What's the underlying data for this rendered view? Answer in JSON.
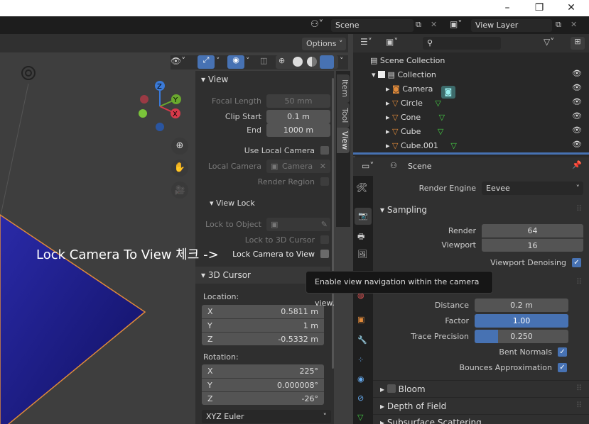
{
  "window": {
    "minimize": "–",
    "maximize": "❐",
    "close": "✕"
  },
  "topbar": {
    "scene": "Scene",
    "view_layer": "View Layer"
  },
  "viewport": {
    "options": "Options"
  },
  "npanel": {
    "tabs": [
      "Item",
      "Tool",
      "View"
    ],
    "view": {
      "header": "View",
      "focal_length_label": "Focal Length",
      "focal_length": "50 mm",
      "clip_start_label": "Clip Start",
      "clip_start": "0.1 m",
      "end_label": "End",
      "end": "1000 m",
      "use_local_camera": "Use Local Camera",
      "local_camera_label": "Local Camera",
      "local_camera_value": "Camera",
      "render_region": "Render Region"
    },
    "view_lock": {
      "header": "View Lock",
      "lock_to_object_label": "Lock to Object",
      "lock_to_3d_cursor": "Lock to 3D Cursor",
      "lock_camera_to_view": "Lock Camera to View"
    },
    "cursor": {
      "header": "3D Cursor",
      "location_label": "Location:",
      "location": [
        {
          "axis": "X",
          "value": "0.5811 m"
        },
        {
          "axis": "Y",
          "value": "1 m"
        },
        {
          "axis": "Z",
          "value": "-0.5332 m"
        }
      ],
      "rotation_label": "Rotation:",
      "rotation": [
        {
          "axis": "X",
          "value": "225°"
        },
        {
          "axis": "Y",
          "value": "0.000008°"
        },
        {
          "axis": "Z",
          "value": "-26°"
        }
      ],
      "rotation_mode": "XYZ Euler"
    }
  },
  "annotation": "Lock Camera To View 체크 ->",
  "tooltip": "Enable view navigation within the camera view.",
  "outliner": {
    "root": "Scene Collection",
    "collection": "Collection",
    "items": [
      "Camera",
      "Circle",
      "Cone",
      "Cube",
      "Cube.001"
    ]
  },
  "properties": {
    "scene_label": "Scene",
    "render_engine_label": "Render Engine",
    "render_engine": "Eevee",
    "sampling": {
      "header": "Sampling",
      "render_label": "Render",
      "render": "64",
      "viewport_label": "Viewport",
      "viewport": "16",
      "denoising": "Viewport Denoising"
    },
    "ao": {
      "distance_label": "Distance",
      "distance": "0.2 m",
      "factor_label": "Factor",
      "factor": "1.00",
      "factor_fill": 1.0,
      "trace_label": "Trace Precision",
      "trace": "0.250",
      "trace_fill": 0.25,
      "bent_normals": "Bent Normals",
      "bounces": "Bounces Approximation"
    },
    "bloom": "Bloom",
    "depth_of_field": "Depth of Field",
    "subsurface": "Subsurface Scattering"
  }
}
